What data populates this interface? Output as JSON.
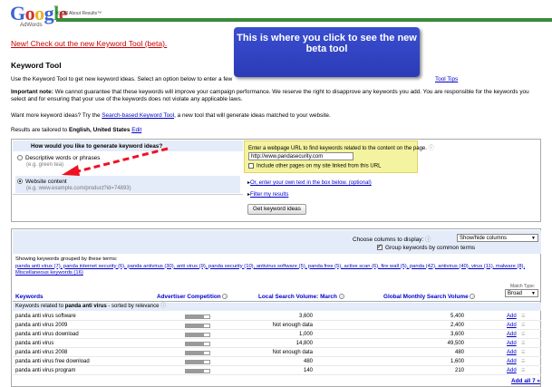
{
  "header": {
    "logo_text": "Google",
    "logo_sub": "AdWords",
    "tagline": "It's All About Results™"
  },
  "new_tool_link": "New! Check out the new Keyword Tool (beta).",
  "callout_text": "This is where you click to see the new beta tool",
  "page_title": "Keyword Tool",
  "intro_text": "Use the Keyword Tool to get new keyword ideas. Select an option below to enter a few",
  "intro_link": "Tool Tips",
  "note_label": "Important note:",
  "note_text": "We cannot guarantee that these keywords will improve your campaign performance. We reserve the right to disapprove any keywords you add. You are responsible for the keywords you select and for ensuring that your use of the keywords does not violate any applicable laws.",
  "more_prefix": "Want more keyword ideas? Try the",
  "more_link": "Search-based Keyword Tool",
  "more_suffix": ", a new tool that will generate ideas matched to your website.",
  "tailored_prefix": "Results are tailored to",
  "tailored_value": "English, United States",
  "tailored_edit": "Edit",
  "options": {
    "question": "How would you like to generate keyword ideas?",
    "descriptive_label": "Descriptive words or phrases",
    "descriptive_hint": "(e.g. green tea)",
    "website_label": "Website content",
    "website_hint": "(e.g. www.example.com/product?id=74893)",
    "url_prompt": "Enter a webpage URL to find keywords related to the content on the page.",
    "url_value": "http://www.pandasecurity.com",
    "include_pages_label": "Include other pages on my site linked from this URL",
    "or_link": "Or, enter your own text in the box below. (optional)",
    "filter_link": "Filter my results",
    "get_button": "Get keyword ideas"
  },
  "results": {
    "choose_cols_label": "Choose columns to display:",
    "choose_cols_value": "Show/hide columns",
    "group_label": "Group keywords by common terms",
    "grouped_prefix": "Showing keywords grouped by these terms:",
    "grouped_terms": "panda anti virus (7), panda internet security (6), panda antivirus (30), anti virus (9), panda security (10), antivirus software (5), panda free (5), active scan (6), fire wall (5), panda (42), antivirus (40), virus (11), malware (8), Miscellaneous keywords (16)",
    "match_type_label": "Match Type:",
    "match_type_value": "Broad",
    "col_keywords": "Keywords",
    "col_competition": "Advertiser Competition",
    "col_local": "Local Search Volume: March",
    "col_global": "Global Monthly Search Volume",
    "group_row_prefix": "Keywords related to",
    "group_row_term": "panda anti virus",
    "group_row_suffix": "- sorted by relevance",
    "add_label": "Add",
    "add_all": "Add all 7 »",
    "rows": [
      {
        "keyword": "panda anti virus software",
        "competition": 0.75,
        "local": "3,600",
        "global": "5,400"
      },
      {
        "keyword": "panda anti virus 2009",
        "competition": 0.75,
        "local": "Not enough data",
        "global": "2,400"
      },
      {
        "keyword": "panda anti virus download",
        "competition": 0.75,
        "local": "1,000",
        "global": "3,600"
      },
      {
        "keyword": "panda anti virus",
        "competition": 0.75,
        "local": "14,800",
        "global": "49,500"
      },
      {
        "keyword": "panda anti virus 2008",
        "competition": 0.75,
        "local": "Not enough data",
        "global": "480"
      },
      {
        "keyword": "panda anti virus free download",
        "competition": 0.75,
        "local": "480",
        "global": "1,600"
      },
      {
        "keyword": "panda anti virus program",
        "competition": 0.75,
        "local": "140",
        "global": "210"
      }
    ]
  }
}
